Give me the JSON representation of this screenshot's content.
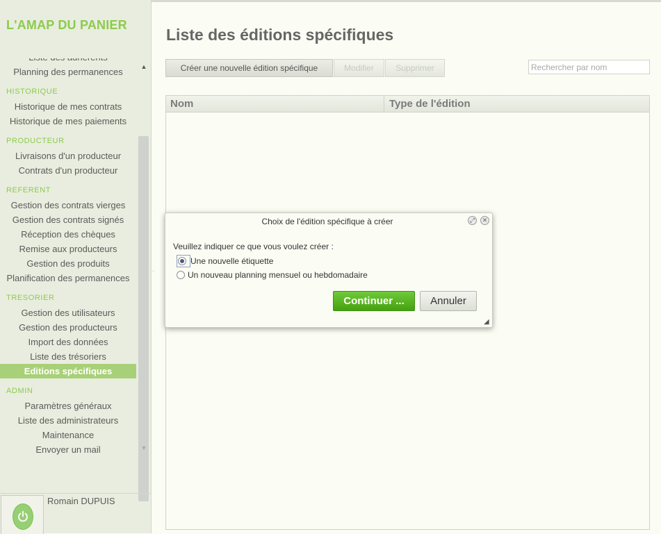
{
  "app": {
    "title": "L'AMAP DU PANIER"
  },
  "sidebar": {
    "partial_item": "Liste des adhérents",
    "items": [
      {
        "type": "item",
        "label": "Planning des permanences"
      },
      {
        "type": "section",
        "label": "HISTORIQUE"
      },
      {
        "type": "item",
        "label": "Historique de mes contrats"
      },
      {
        "type": "item",
        "label": "Historique de mes paiements"
      },
      {
        "type": "section",
        "label": "PRODUCTEUR"
      },
      {
        "type": "item",
        "label": "Livraisons d'un producteur"
      },
      {
        "type": "item",
        "label": "Contrats d'un producteur"
      },
      {
        "type": "section",
        "label": "REFERENT"
      },
      {
        "type": "item",
        "label": "Gestion des contrats vierges"
      },
      {
        "type": "item",
        "label": "Gestion des contrats signés"
      },
      {
        "type": "item",
        "label": "Réception des chèques"
      },
      {
        "type": "item",
        "label": "Remise aux producteurs"
      },
      {
        "type": "item",
        "label": "Gestion des produits"
      },
      {
        "type": "item",
        "label": "Planification des permanences"
      },
      {
        "type": "section",
        "label": "TRESORIER"
      },
      {
        "type": "item",
        "label": "Gestion des utilisateurs"
      },
      {
        "type": "item",
        "label": "Gestion des producteurs"
      },
      {
        "type": "item",
        "label": "Import des données"
      },
      {
        "type": "item",
        "label": "Liste des trésoriers"
      },
      {
        "type": "item",
        "label": "Editions spécifiques",
        "active": true
      },
      {
        "type": "section",
        "label": "ADMIN"
      },
      {
        "type": "item",
        "label": "Paramètres généraux"
      },
      {
        "type": "item",
        "label": "Liste des administrateurs"
      },
      {
        "type": "item",
        "label": "Maintenance"
      },
      {
        "type": "item",
        "label": "Envoyer un mail"
      }
    ],
    "user_name": "Romain DUPUIS",
    "power_icon": "power-icon"
  },
  "main": {
    "title": "Liste des éditions spécifiques",
    "toolbar": {
      "create_label": "Créer une nouvelle édition spécifique",
      "modify_label": "Modifier",
      "delete_label": "Supprimer"
    },
    "search": {
      "placeholder": "Rechercher par nom",
      "value": ""
    },
    "table": {
      "columns": [
        "Nom",
        "Type de l'édition"
      ],
      "rows": []
    }
  },
  "dialog": {
    "title": "Choix de l'édition spécifique à créer",
    "prompt": "Veuillez indiquer ce que vous voulez créer :",
    "options": [
      {
        "label": "Une nouvelle étiquette",
        "selected": true
      },
      {
        "label": "Un nouveau planning mensuel ou hebdomadaire",
        "selected": false
      }
    ],
    "continue_label": "Continuer ...",
    "cancel_label": "Annuler"
  },
  "colors": {
    "accent": "#8ccb4d",
    "active_menu": "#a8d078",
    "continue_button": "#56b124"
  }
}
